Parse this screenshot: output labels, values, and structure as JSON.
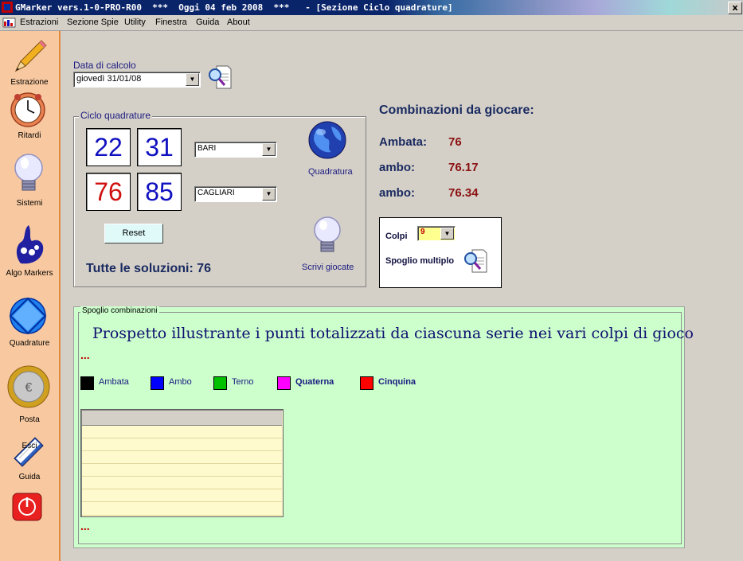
{
  "window": {
    "title": "GMarker vers.1-0-PRO-R00  ***  Oggi 04 feb 2008  ***   - [Sezione Ciclo quadrature]",
    "close_label": "x"
  },
  "menu": [
    "Estrazioni",
    "Sezione Spie",
    "Utility",
    "Finestra",
    "Guida",
    "About"
  ],
  "sidebar": [
    {
      "label": "Estrazione",
      "icon": "pencil-icon"
    },
    {
      "label": "Ritardi",
      "icon": "clock-icon"
    },
    {
      "label": "Sistemi",
      "icon": "lightbulb-icon"
    },
    {
      "label": "Algo Markers",
      "icon": "lottery-hand-icon"
    },
    {
      "label": "Quadrature",
      "icon": "diamond-circle-icon"
    },
    {
      "label": "Posta",
      "icon": "euro-coin-icon"
    },
    {
      "label": "Guida",
      "icon": "book-icon",
      "badge": "Esci"
    },
    {
      "label": "",
      "icon": "power-icon"
    }
  ],
  "calc": {
    "label": "Data di calcolo",
    "date_value": "giovedì 31/01/08"
  },
  "ciclo": {
    "title": "Ciclo quadrature",
    "numbers": [
      "22",
      "31",
      "76",
      "85"
    ],
    "number_colors": [
      "#1010c0",
      "#1010c0",
      "#d01010",
      "#1010c0"
    ],
    "wheel1": "BARI",
    "wheel2": "CAGLIARI",
    "quadratura_label": "Quadratura",
    "reset_label": "Reset",
    "solutions": "Tutte le soluzioni: 76",
    "scrivi_label": "Scrivi giocate"
  },
  "combinations": {
    "title": "Combinazioni da giocare:",
    "rows": [
      {
        "label": "Ambata:",
        "value": "76"
      },
      {
        "label": "ambo:",
        "value": "76.17"
      },
      {
        "label": "ambo:",
        "value": "76.34"
      }
    ]
  },
  "colpi": {
    "label": "Colpi",
    "value": "9",
    "spoglio_multiplo": "Spoglio multiplo"
  },
  "spoglio": {
    "title": "Spoglio combinazioni",
    "heading": "Prospetto illustrante i punti totalizzati da ciascuna serie nei vari colpi di gioco",
    "ellipsis_top": "...",
    "ellipsis_bottom": "...",
    "legend": [
      {
        "label": "Ambata",
        "color": "#000000"
      },
      {
        "label": "Ambo",
        "color": "#0000ff"
      },
      {
        "label": "Terno",
        "color": "#00c000"
      },
      {
        "label": "Quaterna",
        "color": "#ff00ff"
      },
      {
        "label": "Cinquina",
        "color": "#ff0000"
      }
    ]
  }
}
